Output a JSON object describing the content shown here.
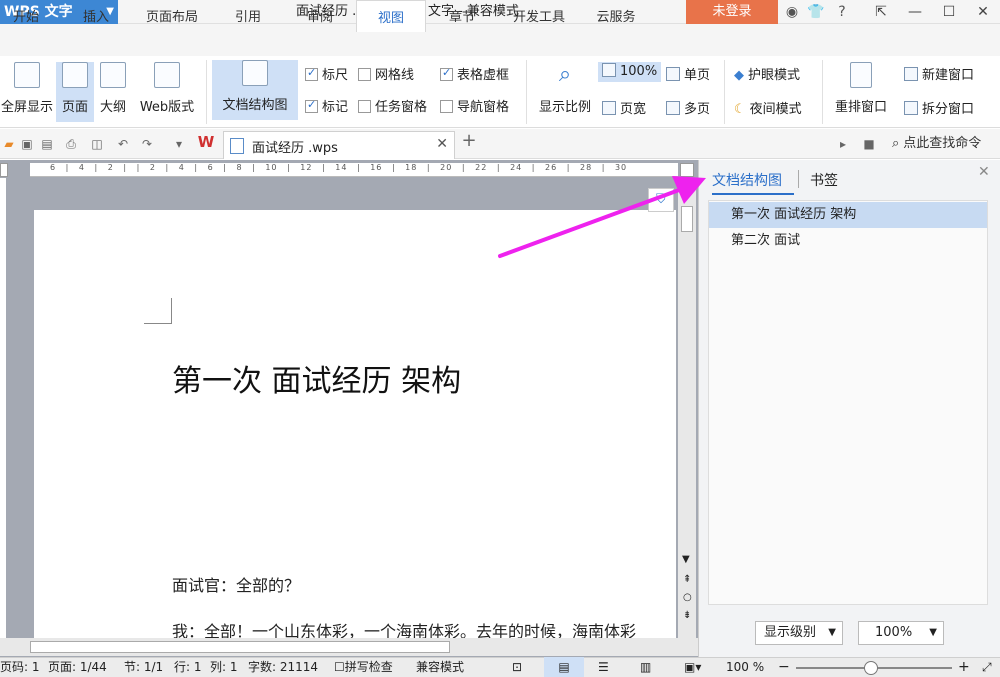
{
  "title_bar": {
    "app_name": "WPS 文字",
    "document_title": "面试经历 .wps - WPS 文字 - 兼容模式",
    "login_button": "未登录",
    "window_controls": [
      "restore",
      "minimize",
      "maximize",
      "close"
    ]
  },
  "tabs": [
    {
      "label": "开始",
      "active": false
    },
    {
      "label": "插入",
      "active": false
    },
    {
      "label": "页面布局",
      "active": false
    },
    {
      "label": "引用",
      "active": false
    },
    {
      "label": "审阅",
      "active": false
    },
    {
      "label": "视图",
      "active": true
    },
    {
      "label": "章节",
      "active": false
    },
    {
      "label": "开发工具",
      "active": false
    },
    {
      "label": "云服务",
      "active": false
    }
  ],
  "ribbon": {
    "fullscreen": "全屏显示",
    "page_view": "页面",
    "outline_view": "大纲",
    "web_view": "Web版式",
    "doc_structure": "文档结构图",
    "checkboxes": {
      "ruler": {
        "label": "标尺",
        "checked": true
      },
      "gridlines": {
        "label": "网格线",
        "checked": false
      },
      "table_borders": {
        "label": "表格虚框",
        "checked": true
      },
      "marks": {
        "label": "标记",
        "checked": true
      },
      "task_pane": {
        "label": "任务窗格",
        "checked": false
      },
      "nav_pane": {
        "label": "导航窗格",
        "checked": false
      }
    },
    "zoom_ratio": "显示比例",
    "zoom_100": "100%",
    "page_width": "页宽",
    "single_page": "单页",
    "multi_page": "多页",
    "eye_mode": "护眼模式",
    "night_mode": "夜间模式",
    "arrange_windows": "重排窗口",
    "new_window": "新建窗口",
    "split_window": "拆分窗口"
  },
  "quick_bar": {
    "doc_tab_label": "面试经历 .wps",
    "find_command": "点此查找命令"
  },
  "ruler_labels": "6 | 4 | 2 | | 2 | 4 | 6 | 8 | 10 | 12 | 14 | 16 | 18 | 20 | 22 | 24 | 26 | 28 | 30",
  "document": {
    "heading": "第一次   面试经历 架构",
    "paragraph1": "面试官：全部的？",
    "paragraph2": "我：全部！一个山东体彩，一个海南体彩。去年的时候，海南体彩"
  },
  "panel": {
    "tab_structure": "文档结构图",
    "tab_bookmarks": "书签",
    "outline_items": [
      {
        "label": "第一次   面试经历 架构",
        "selected": true
      },
      {
        "label": "第二次  面试",
        "selected": false
      }
    ],
    "display_level": "显示级别",
    "zoom": "100%"
  },
  "status_bar": {
    "page_code": "页码: 1",
    "page": "页面: 1/44",
    "section": "节: 1/1",
    "row": "行: 1",
    "col": "列: 1",
    "word_count": "字数: 21114",
    "spell_check": "拼写检查",
    "compat_mode": "兼容模式",
    "zoom_percent": "100 %"
  },
  "colors": {
    "accent": "#2b6fc9",
    "app_blue": "#3d87d4",
    "login_orange": "#e8734a",
    "arrow_magenta": "#ee22ee"
  }
}
